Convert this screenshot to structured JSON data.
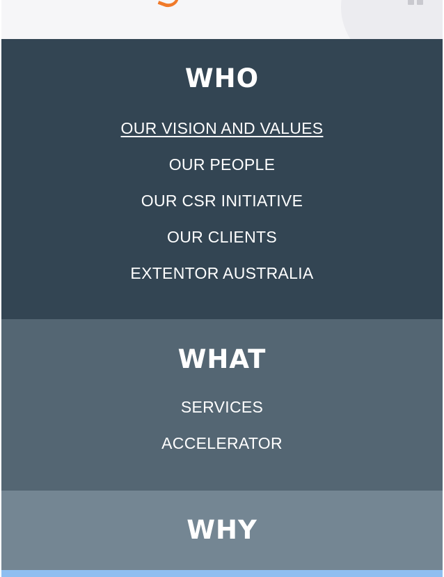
{
  "nav": {
    "who": {
      "heading": "WHO",
      "links": [
        {
          "label": "OUR VISION AND VALUES"
        },
        {
          "label": "OUR PEOPLE"
        },
        {
          "label": "OUR CSR INITIATIVE"
        },
        {
          "label": "OUR CLIENTS"
        },
        {
          "label": "EXTENTOR AUSTRALIA"
        }
      ]
    },
    "what": {
      "heading": "WHAT",
      "links": [
        {
          "label": "SERVICES"
        },
        {
          "label": "ACCELERATOR"
        }
      ]
    },
    "why": {
      "heading": "WHY"
    }
  },
  "colors": {
    "who_bg": "#334553",
    "what_bg": "#546673",
    "why_bg": "#748693",
    "accent": "#f07a2a"
  },
  "icons": {
    "header_menu": "menu-icon",
    "brand": "logo-icon"
  }
}
